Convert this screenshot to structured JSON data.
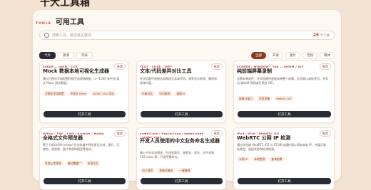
{
  "page": {
    "top_title": "十大工具箱"
  },
  "section": {
    "kicker": "TOOLS",
    "title": "可用工具"
  },
  "search": {
    "placeholder": "搜索工具、格式或关键词",
    "count": "25",
    "count_suffix": "个工具"
  },
  "tabs": [
    "卡片",
    "紧凑",
    "列表"
  ],
  "filters": [
    "全部",
    "开发",
    "图片",
    "音频",
    "媒体"
  ],
  "cards": [
    {
      "tag": "FAKER — JSON / CSV",
      "badge": "推荐",
      "title": "Mock 数据本地可视化生成器",
      "desc": "通过可视化字段配置快速生成表格数据（1～1000 条中文/英文 Mock 测试数据。",
      "chips": [
        "可视化字段配置",
        "中英文 Faker",
        "JSON / CSV 导出"
      ],
      "button": "打开工具"
    },
    {
      "tag": "TEXT / CODE / DIFF",
      "badge": "推荐",
      "title": "文本/代码差异对比工具",
      "desc": "在浏览器中直接比较两段文本或代码，高亮显示新增、删除和修改内容。",
      "chips": [
        "行级对比",
        "行内高亮",
        "清爽UI"
      ],
      "button": "打开工具"
    },
    {
      "tag": "SCREEN / WINDOW / TAB — WEBM / GIF",
      "badge": "推荐",
      "title": "纯前端屏幕录制",
      "desc": "无需安装软件，在浏览器中直接录制整个屏幕、应用窗口或标签页，并导出 WebM 视频或可预览 GIF。",
      "chips": [
        "屏幕与窗口",
        "声音采集",
        "WebM / GIF"
      ],
      "button": "打开工具"
    },
    {
      "tag": "Office / PDF / CAD / Archive / Media",
      "badge": "推荐",
      "title": "全格式文件预览器",
      "desc": "基于 fyfish/file-viewer 在浏览器中预览常见文档、图片、压缩包、音视频、图片和多种模型等格式。",
      "chips": [
        "本地上传预览",
        "格式覆盖广",
        "多项交互"
      ],
      "button": "打开工具"
    },
    {
      "tag": "camelCase / PascalCase / kebab-case / snake_case",
      "badge": "推荐",
      "title": "开发人员使用的中文业务命名生成器",
      "desc": "输入中文业务描述，生成变量名、函数名、类名、文件名和 CSS class 等，开发所需命名。",
      "chips": [
        "词义规范",
        "多格式输出",
        "一键复制"
      ],
      "button": "打开工具"
    },
    {
      "tag": "IPv4 / IPv6 / WebRTC ICE",
      "badge": "推荐",
      "title": "WebRTC 公网 IP 检测",
      "desc": "通过浏览器 WebRTC ICE 与 STUN 连通检测公网和本地 IP，并展示候选类型、连接状态和检测结果。",
      "chips": [
        "公网 IP",
        "本地检测",
        "查询结果"
      ],
      "button": "打开工具"
    }
  ]
}
